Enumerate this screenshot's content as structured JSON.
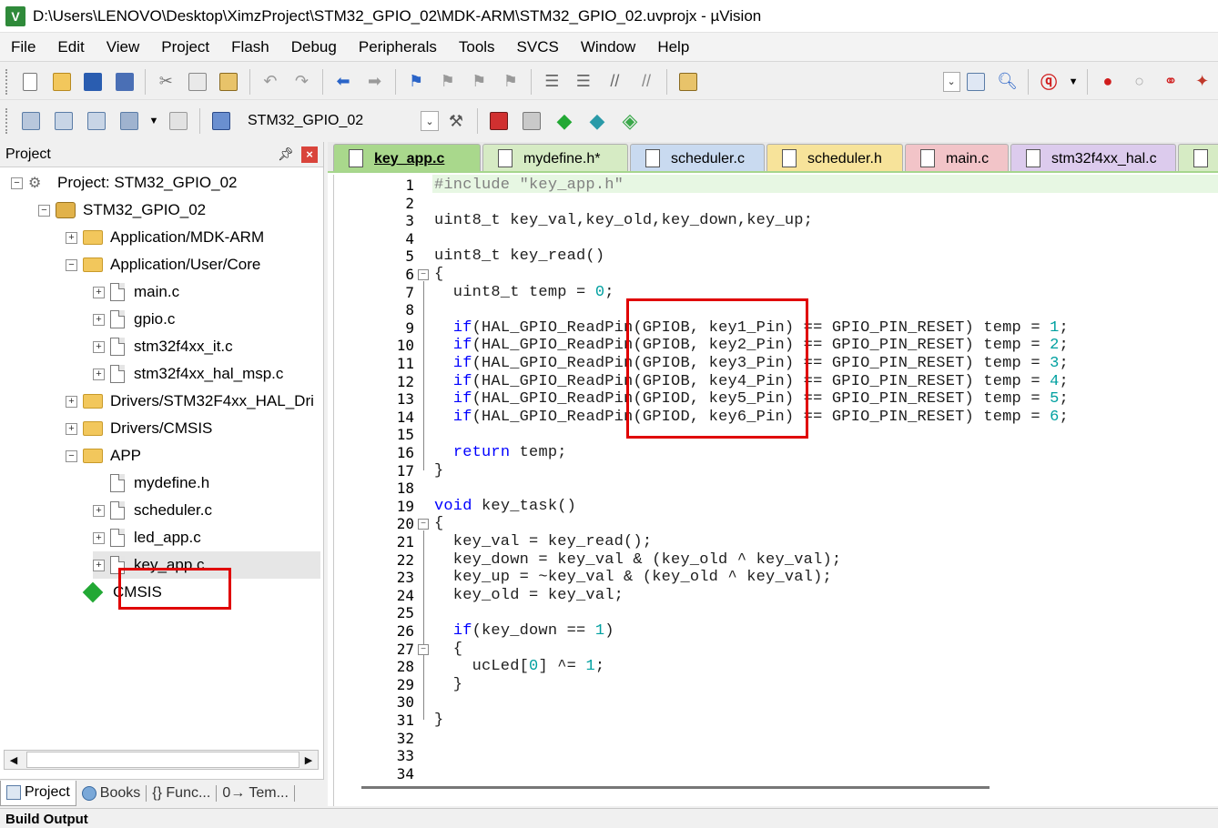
{
  "window": {
    "title": "D:\\Users\\LENOVO\\Desktop\\XimzProject\\STM32_GPIO_02\\MDK-ARM\\STM32_GPIO_02.uvprojx - µVision",
    "app_icon": "V"
  },
  "menu": [
    "File",
    "Edit",
    "View",
    "Project",
    "Flash",
    "Debug",
    "Peripherals",
    "Tools",
    "SVCS",
    "Window",
    "Help"
  ],
  "toolbar2": {
    "target_name": "STM32_GPIO_02"
  },
  "project_panel": {
    "title": "Project",
    "tree": [
      {
        "label": "Project: STM32_GPIO_02",
        "kind": "project",
        "expander": "−"
      },
      {
        "label": "STM32_GPIO_02",
        "kind": "target",
        "expander": "−"
      },
      {
        "label": "Application/MDK-ARM",
        "kind": "folder",
        "expander": "+"
      },
      {
        "label": "Application/User/Core",
        "kind": "folder",
        "expander": "−"
      },
      {
        "label": "main.c",
        "kind": "file",
        "expander": "+"
      },
      {
        "label": "gpio.c",
        "kind": "file",
        "expander": "+"
      },
      {
        "label": "stm32f4xx_it.c",
        "kind": "file",
        "expander": "+"
      },
      {
        "label": "stm32f4xx_hal_msp.c",
        "kind": "file",
        "expander": "+"
      },
      {
        "label": "Drivers/STM32F4xx_HAL_Dri",
        "kind": "folder",
        "expander": "+"
      },
      {
        "label": "Drivers/CMSIS",
        "kind": "folder",
        "expander": "+"
      },
      {
        "label": "APP",
        "kind": "folder",
        "expander": "−"
      },
      {
        "label": "mydefine.h",
        "kind": "file",
        "expander": ""
      },
      {
        "label": "scheduler.c",
        "kind": "file",
        "expander": "+"
      },
      {
        "label": "led_app.c",
        "kind": "file",
        "expander": "+"
      },
      {
        "label": "key_app.c",
        "kind": "file",
        "expander": "+"
      },
      {
        "label": "CMSIS",
        "kind": "cmsis",
        "expander": ""
      }
    ],
    "bottom_tabs": [
      "Project",
      "Books",
      "{} Func...",
      "0→ Tem..."
    ]
  },
  "editor": {
    "tabs": [
      {
        "label": "key_app.c",
        "color": "#a9d88c",
        "active": true
      },
      {
        "label": "mydefine.h*",
        "color": "#d6ebc4",
        "active": false
      },
      {
        "label": "scheduler.c",
        "color": "#c9daf0",
        "active": false
      },
      {
        "label": "scheduler.h",
        "color": "#f7e39a",
        "active": false
      },
      {
        "label": "main.c",
        "color": "#f2c4c8",
        "active": false
      },
      {
        "label": "stm32f4xx_hal.c",
        "color": "#dccbed",
        "active": false
      },
      {
        "label": "",
        "color": "#d6ebc4",
        "active": false
      }
    ],
    "line_numbers": [
      "1",
      "2",
      "3",
      "4",
      "5",
      "6",
      "7",
      "8",
      "9",
      "10",
      "11",
      "12",
      "13",
      "14",
      "15",
      "16",
      "17",
      "18",
      "19",
      "20",
      "21",
      "22",
      "23",
      "24",
      "25",
      "26",
      "27",
      "28",
      "29",
      "30",
      "31",
      "32",
      "33",
      "34"
    ],
    "code_lines": [
      "#include \"key_app.h\"",
      "",
      "uint8_t key_val,key_old,key_down,key_up;",
      "",
      "uint8_t key_read()",
      "{",
      "  uint8_t temp = 0;",
      "",
      "  if(HAL_GPIO_ReadPin(GPIOB, key1_Pin) == GPIO_PIN_RESET) temp = 1;",
      "  if(HAL_GPIO_ReadPin(GPIOB, key2_Pin) == GPIO_PIN_RESET) temp = 2;",
      "  if(HAL_GPIO_ReadPin(GPIOB, key3_Pin) == GPIO_PIN_RESET) temp = 3;",
      "  if(HAL_GPIO_ReadPin(GPIOB, key4_Pin) == GPIO_PIN_RESET) temp = 4;",
      "  if(HAL_GPIO_ReadPin(GPIOD, key5_Pin) == GPIO_PIN_RESET) temp = 5;",
      "  if(HAL_GPIO_ReadPin(GPIOD, key6_Pin) == GPIO_PIN_RESET) temp = 6;",
      "",
      "  return temp;",
      "}",
      "",
      "void key_task()",
      "{",
      "  key_val = key_read();",
      "  key_down = key_val & (key_old ^ key_val);",
      "  key_up = ~key_val & (key_old ^ key_val);",
      "  key_old = key_val;",
      "",
      "  if(key_down == 1)",
      "  {",
      "    ucLed[0] ^= 1;",
      "  }",
      "",
      "}",
      "",
      "",
      ""
    ]
  },
  "status": {
    "build_output_label": "Build Output"
  },
  "colors": {
    "accent_green": "#a6d68d",
    "keyword": "#0000ff",
    "number": "#00a0a0",
    "highlight_box": "#e00000"
  }
}
